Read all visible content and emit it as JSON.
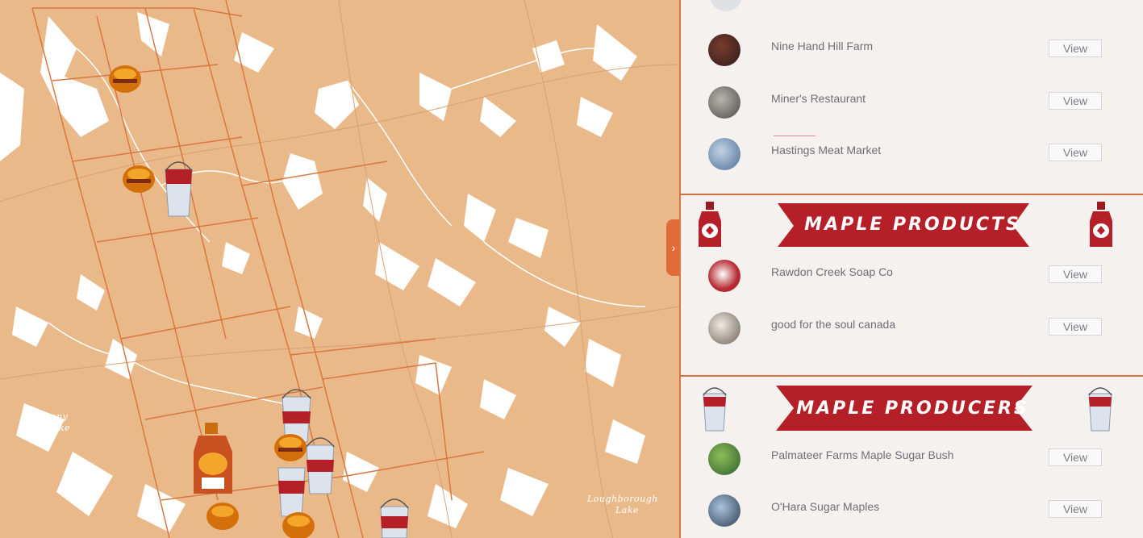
{
  "map": {
    "labels": [
      "Stony",
      "Lake",
      "Loughborough",
      "Lake"
    ],
    "toggle_glyph": "›"
  },
  "sections": [
    {
      "title": "",
      "items": [
        {
          "name": "Nine Hand Hill Farm",
          "button": "View"
        },
        {
          "name": "Miner's Restaurant",
          "button": "View"
        },
        {
          "name": "Hastings Meat Market",
          "button": "View"
        }
      ]
    },
    {
      "title": "MAPLE PRODUCTS",
      "icon": "maple-syrup-bottle-icon",
      "items": [
        {
          "name": "Rawdon Creek Soap Co",
          "button": "View"
        },
        {
          "name": "good for the soul canada",
          "button": "View"
        }
      ]
    },
    {
      "title": "MAPLE PRODUCERS",
      "icon": "sap-bucket-icon",
      "items": [
        {
          "name": "Palmateer Farms Maple Sugar Bush",
          "button": "View"
        },
        {
          "name": "O'Hara Sugar Maples",
          "button": "View"
        }
      ]
    }
  ],
  "colors": {
    "map_background": "#eab98a",
    "township_lines": "#d9773f",
    "banner_red": "#b51f28",
    "divider": "#cf7240"
  }
}
